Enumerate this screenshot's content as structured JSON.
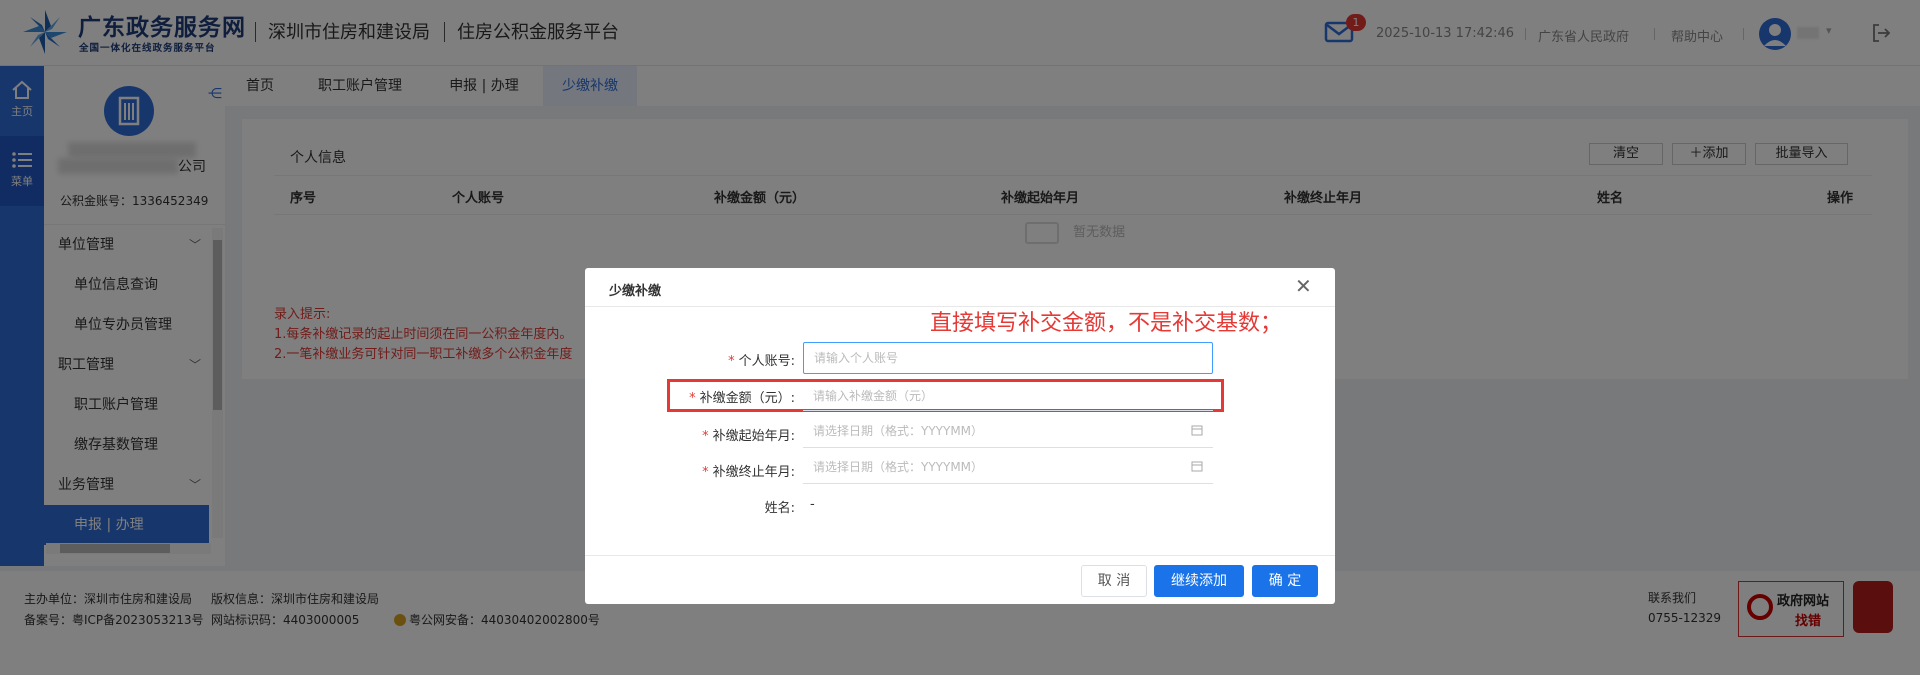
{
  "header": {
    "brand_main": "广东政务服务网",
    "brand_sub": "全国一体化在线政务服务平台",
    "bureau": "深圳市住房和建设局",
    "platform": "住房公积金服务平台",
    "mail_badge": "1",
    "datetime": "2025-10-13 17:42:46",
    "gov_link": "广东省人民政府",
    "help_link": "帮助中心"
  },
  "rail": {
    "home": "主页",
    "menu": "菜单"
  },
  "sidebar": {
    "org_suffix": "公司",
    "fund_account": "公积金账号：1336452349",
    "groups": [
      {
        "label": "单位管理",
        "items": [
          "单位信息查询",
          "单位专办员管理"
        ]
      },
      {
        "label": "职工管理",
        "items": [
          "职工账户管理",
          "缴存基数管理"
        ]
      },
      {
        "label": "业务管理",
        "items": [
          "申报 | 办理"
        ]
      }
    ]
  },
  "tabs": [
    "首页",
    "职工账户管理",
    "申报 | 办理",
    "少缴补缴"
  ],
  "content": {
    "section_title": "个人信息",
    "buttons": {
      "clear": "清空",
      "add": "＋添加",
      "import": "批量导入"
    },
    "columns": [
      "序号",
      "个人账号",
      "补缴金额（元）",
      "补缴起始年月",
      "补缴终止年月",
      "姓名",
      "操作"
    ],
    "empty_text": "暂无数据",
    "tips": [
      "录入提示:",
      "1.每条补缴记录的起止时间须在同一公积金年度内。",
      "2.一笔补缴业务可针对同一职工补缴多个公积金年度"
    ]
  },
  "footer": {
    "sponsor": "主办单位：深圳市住房和建设局",
    "copyright": "版权信息：深圳市住房和建设局",
    "icp": "备案号：粤ICP备2023053213号",
    "site_code": "网站标识码：4403000005",
    "police": "粤公网安备：44030402002800号",
    "contact_label": "联系我们",
    "contact_phone": "0755-12329",
    "gov_badge_1": "政府网站",
    "gov_badge_2": "找错"
  },
  "dialog": {
    "title": "少缴补缴",
    "note": "直接填写补交金额，不是补交基数；",
    "fields": {
      "account_label": "个人账号:",
      "account_placeholder": "请输入个人账号",
      "amount_label": "补缴金额（元）:",
      "amount_placeholder": "请输入补缴金额（元）",
      "start_label": "补缴起始年月:",
      "start_placeholder": "请选择日期（格式：YYYYMM）",
      "end_label": "补缴终止年月:",
      "end_placeholder": "请选择日期（格式：YYYYMM）",
      "name_label": "姓名:",
      "name_value": "-"
    },
    "buttons": {
      "cancel": "取 消",
      "continue": "继续添加",
      "confirm": "确 定"
    }
  },
  "colors": {
    "primary": "#2f6cd8",
    "accent_red": "#e53935",
    "button_blue": "#1a73e8"
  }
}
